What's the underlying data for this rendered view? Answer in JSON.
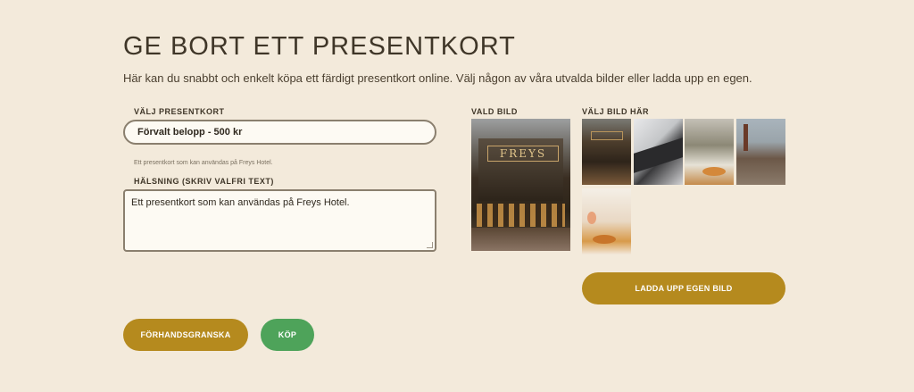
{
  "page": {
    "title": "GE BORT ETT PRESENTKORT",
    "intro": "Här kan du snabbt och enkelt köpa ett färdigt presentkort online. Välj någon av våra utvalda bilder eller ladda upp en egen."
  },
  "form": {
    "card_label": "VÄLJ PRESENTKORT",
    "card_value": "Förvalt belopp - 500 kr",
    "card_hint": "Ett presentkort som kan användas på Freys Hotel.",
    "greeting_label": "HÄLSNING (SKRIV VALFRI TEXT)",
    "greeting_value": "Ett presentkort som kan användas på Freys Hotel."
  },
  "images": {
    "selected_label": "VALD BILD",
    "choose_label": "VÄLJ BILD HÄR",
    "selected_sign": "FREYS",
    "thumbnails": [
      "hotel-facade",
      "building-abstract",
      "terrace-food",
      "city-view",
      "breakfast"
    ]
  },
  "buttons": {
    "upload": "LADDA UPP EGEN BILD",
    "preview": "FÖRHANDSGRANSKA",
    "buy": "KÖP"
  },
  "colors": {
    "background": "#f3eadb",
    "gold": "#b58a1e",
    "green": "#4ea35a"
  }
}
